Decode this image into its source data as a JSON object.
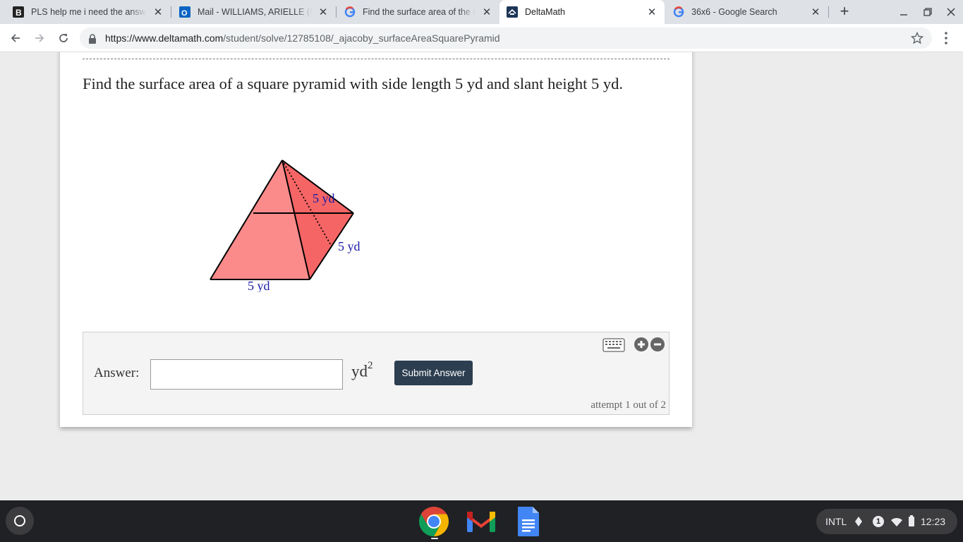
{
  "browser": {
    "tabs": [
      {
        "title": "PLS help me i need the answer",
        "favicon": "brainly-icon",
        "active": false
      },
      {
        "title": "Mail - WILLIAMS, ARIELLE (RL",
        "favicon": "outlook-icon",
        "active": false
      },
      {
        "title": "Find the surface area of the re",
        "favicon": "google-icon",
        "active": false
      },
      {
        "title": "DeltaMath",
        "favicon": "deltamath-icon",
        "active": true
      },
      {
        "title": "36x6 - Google Search",
        "favicon": "google-icon",
        "active": false
      }
    ],
    "url_host": "https://www.deltamath.com",
    "url_path": "/student/solve/12785108/_ajacoby_surfaceAreaSquarePyramid"
  },
  "problem": {
    "text": "Find the surface area of a square pyramid with side length 5 yd and slant height 5 yd.",
    "figure_labels": {
      "slant_height": "5 yd",
      "right_edge": "5 yd",
      "base_edge": "5 yd"
    }
  },
  "answer": {
    "label": "Answer:",
    "value": "",
    "unit_base": "yd",
    "unit_exp": "2",
    "submit_label": "Submit Answer",
    "attempt_text": "attempt 1 out of 2"
  },
  "shelf": {
    "apps": [
      "chrome-icon",
      "gmail-icon",
      "docs-icon"
    ],
    "ime": "INTL",
    "notification_count": "1",
    "time": "12:23"
  },
  "colors": {
    "pyramid_front": "#fb8b8b",
    "pyramid_side": "#f66565",
    "pyramid_back": "#ff9d9d",
    "label": "#1a1aa6",
    "submit_bg": "#2c3e50"
  }
}
